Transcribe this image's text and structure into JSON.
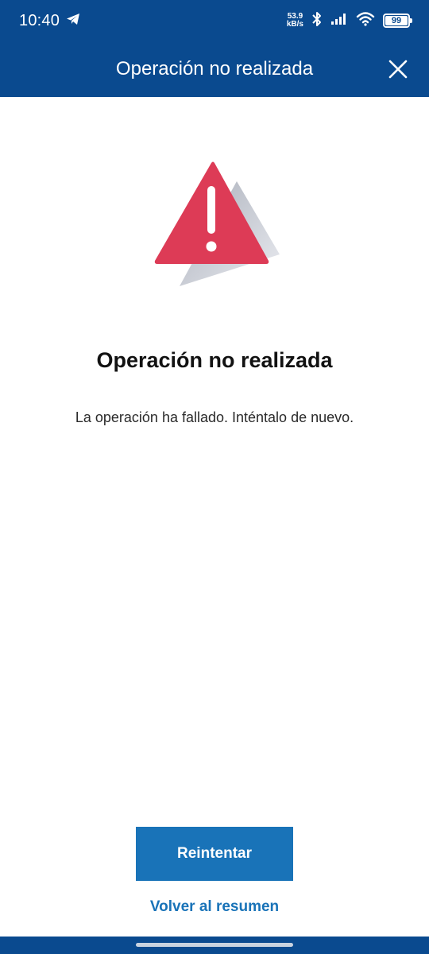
{
  "status_bar": {
    "time": "10:40",
    "net_speed_value": "53.9",
    "net_speed_unit": "kB/s",
    "battery_level": "99",
    "icons": [
      "telegram-icon",
      "bluetooth-icon",
      "signal-icon",
      "wifi-icon",
      "battery-icon"
    ]
  },
  "header": {
    "title": "Operación no realizada",
    "close_icon": "close-icon"
  },
  "content": {
    "illustration_icon": "warning-triangle-icon",
    "title": "Operación no realizada",
    "message": "La operación ha fallado. Inténtalo de nuevo."
  },
  "actions": {
    "retry_label": "Reintentar",
    "back_label": "Volver al resumen"
  },
  "colors": {
    "brand_blue": "#0a4a8f",
    "button_blue": "#1973b8",
    "warning_red": "#dd3b56"
  }
}
